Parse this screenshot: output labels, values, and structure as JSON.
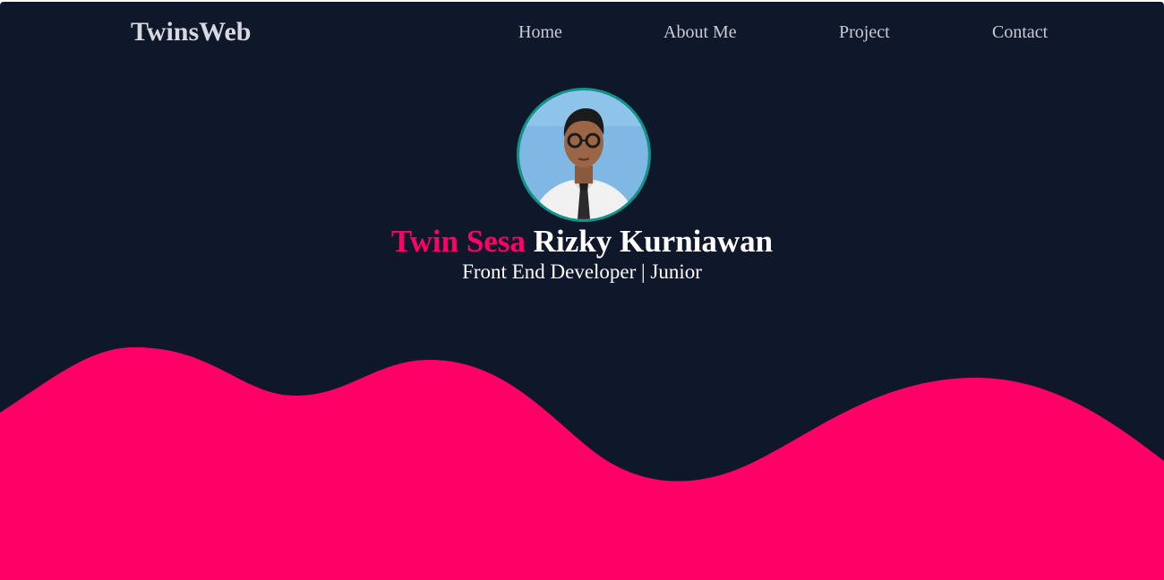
{
  "header": {
    "brand": "TwinsWeb",
    "nav": [
      {
        "label": "Home"
      },
      {
        "label": "About Me"
      },
      {
        "label": "Project"
      },
      {
        "label": "Contact"
      }
    ]
  },
  "hero": {
    "name_first": "Twin Sesa",
    "name_rest": "Rizky Kurniawan",
    "subtitle": "Front End Developer | Junior"
  },
  "colors": {
    "background": "#0f172a",
    "accent": "#ff0066",
    "avatar_border": "#109488"
  }
}
